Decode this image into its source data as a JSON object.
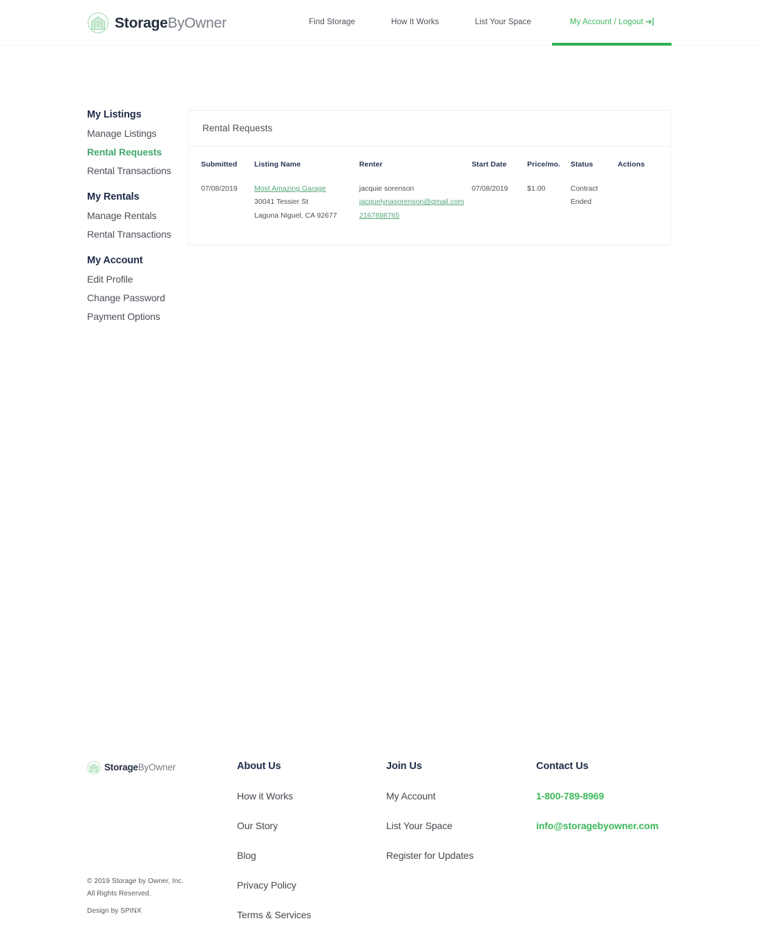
{
  "brand": {
    "name_bold": "Storage",
    "name_light": "ByOwner",
    "logo_icon": "storage-unit-logo-icon",
    "accent_color": "#3cb75a"
  },
  "header": {
    "nav": [
      {
        "label": "Find Storage",
        "active": false
      },
      {
        "label": "How It Works",
        "active": false
      },
      {
        "label": "List Your Space",
        "active": false
      },
      {
        "label": "My Account / Logout",
        "active": true,
        "icon": "logout-arrow-icon"
      }
    ]
  },
  "sidebar": {
    "groups": [
      {
        "title": "My Listings",
        "items": [
          {
            "label": "Manage Listings",
            "active": false
          },
          {
            "label": "Rental Requests",
            "active": true
          },
          {
            "label": "Rental Transactions",
            "active": false
          }
        ]
      },
      {
        "title": "My Rentals",
        "items": [
          {
            "label": "Manage Rentals",
            "active": false
          },
          {
            "label": "Rental Transactions",
            "active": false
          }
        ]
      },
      {
        "title": "My Account",
        "items": [
          {
            "label": "Edit Profile",
            "active": false
          },
          {
            "label": "Change Password",
            "active": false
          },
          {
            "label": "Payment Options",
            "active": false
          }
        ]
      }
    ]
  },
  "main": {
    "card_title": "Rental Requests",
    "columns": [
      "Submitted",
      "Listing Name",
      "Renter",
      "Start Date",
      "Price/mo.",
      "Status",
      "Actions"
    ],
    "rows": [
      {
        "submitted": "07/08/2019",
        "listing_name": "Most Amazing Garage",
        "listing_street": "30041 Tessier St",
        "listing_city": "Laguna Niguel, CA 92677",
        "renter_name": "jacquie sorenson",
        "renter_email": "jacquelynasorenson@gmail.com",
        "renter_phone": "2167898765",
        "start_date": "07/08/2019",
        "price": "$1.00",
        "status_line1": "Contract",
        "status_line2": "Ended",
        "actions": ""
      }
    ]
  },
  "footer": {
    "copyright_line1": "© 2019 Storage by Owner, Inc.",
    "copyright_line2": "All Rights Reserved.",
    "design_by": "Design by SPINX",
    "columns": [
      {
        "heading": "About Us",
        "links": [
          {
            "label": "How it Works",
            "green": false
          },
          {
            "label": "Our Story",
            "green": false
          },
          {
            "label": "Blog",
            "green": false
          },
          {
            "label": "Privacy Policy",
            "green": false
          },
          {
            "label": "Terms & Services",
            "green": false
          }
        ]
      },
      {
        "heading": "Join Us",
        "links": [
          {
            "label": "My Account",
            "green": false
          },
          {
            "label": "List Your Space",
            "green": false
          },
          {
            "label": "Register for Updates",
            "green": false
          }
        ]
      },
      {
        "heading": "Contact Us",
        "links": [
          {
            "label": "1-800-789-8969",
            "green": true
          },
          {
            "label": "info@storagebyowner.com",
            "green": true
          }
        ]
      }
    ]
  }
}
